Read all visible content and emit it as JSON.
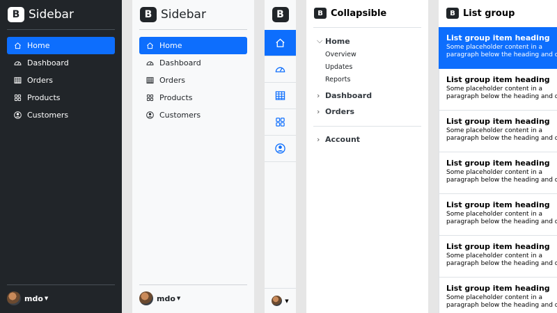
{
  "brand": {
    "logo_letter": "B",
    "title": "Sidebar"
  },
  "nav": [
    {
      "label": "Home",
      "icon": "home-icon",
      "active": true
    },
    {
      "label": "Dashboard",
      "icon": "speedometer-icon",
      "active": false
    },
    {
      "label": "Orders",
      "icon": "table-icon",
      "active": false
    },
    {
      "label": "Products",
      "icon": "grid-icon",
      "active": false
    },
    {
      "label": "Customers",
      "icon": "user-circle-icon",
      "active": false
    }
  ],
  "user": {
    "name": "mdo"
  },
  "collapsible": {
    "title": "Collapsible",
    "home": "Home",
    "home_items": [
      "Overview",
      "Updates",
      "Reports"
    ],
    "dashboard": "Dashboard",
    "orders": "Orders",
    "account": "Account"
  },
  "list_group": {
    "title": "List group",
    "items": [
      {
        "heading": "List group item heading",
        "text1": "Some placeholder content in a",
        "text2": "paragraph below the heading and date.",
        "active": true
      },
      {
        "heading": "List group item heading",
        "text1": "Some placeholder content in a",
        "text2": "paragraph below the heading and date.",
        "active": false
      },
      {
        "heading": "List group item heading",
        "text1": "Some placeholder content in a",
        "text2": "paragraph below the heading and date.",
        "active": false
      },
      {
        "heading": "List group item heading",
        "text1": "Some placeholder content in a",
        "text2": "paragraph below the heading and date.",
        "active": false
      },
      {
        "heading": "List group item heading",
        "text1": "Some placeholder content in a",
        "text2": "paragraph below the heading and date.",
        "active": false
      },
      {
        "heading": "List group item heading",
        "text1": "Some placeholder content in a",
        "text2": "paragraph below the heading and date.",
        "active": false
      },
      {
        "heading": "List group item heading",
        "text1": "Some placeholder content in a",
        "text2": "paragraph below the heading and date.",
        "active": false
      }
    ]
  },
  "colors": {
    "accent": "#0d6efd",
    "dark": "#212529",
    "light": "#f8f9fa"
  }
}
